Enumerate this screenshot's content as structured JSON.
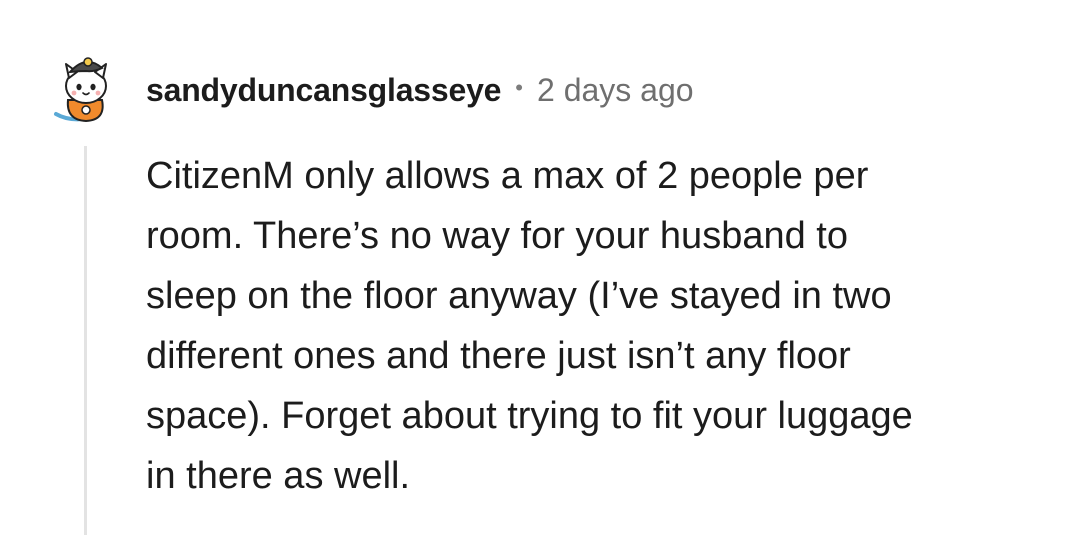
{
  "comment": {
    "username": "sandyduncansglasseye",
    "separator": "•",
    "timestamp": "2 days ago",
    "avatar_icon": "cat-snoo-avatar-icon",
    "body_lines": [
      "CitizenM only allows a max of 2 people per",
      "room. There’s no way for your husband to",
      "sleep on the floor anyway (I’ve stayed in two",
      "different ones and there just isn’t any floor",
      "space). Forget about trying to fit your luggage",
      "in there as well."
    ]
  },
  "colors": {
    "text": "#1c1c1c",
    "meta": "#6f6f6f",
    "thread_line": "#e3e3e3",
    "avatar_shirt": "#f08a2c"
  }
}
